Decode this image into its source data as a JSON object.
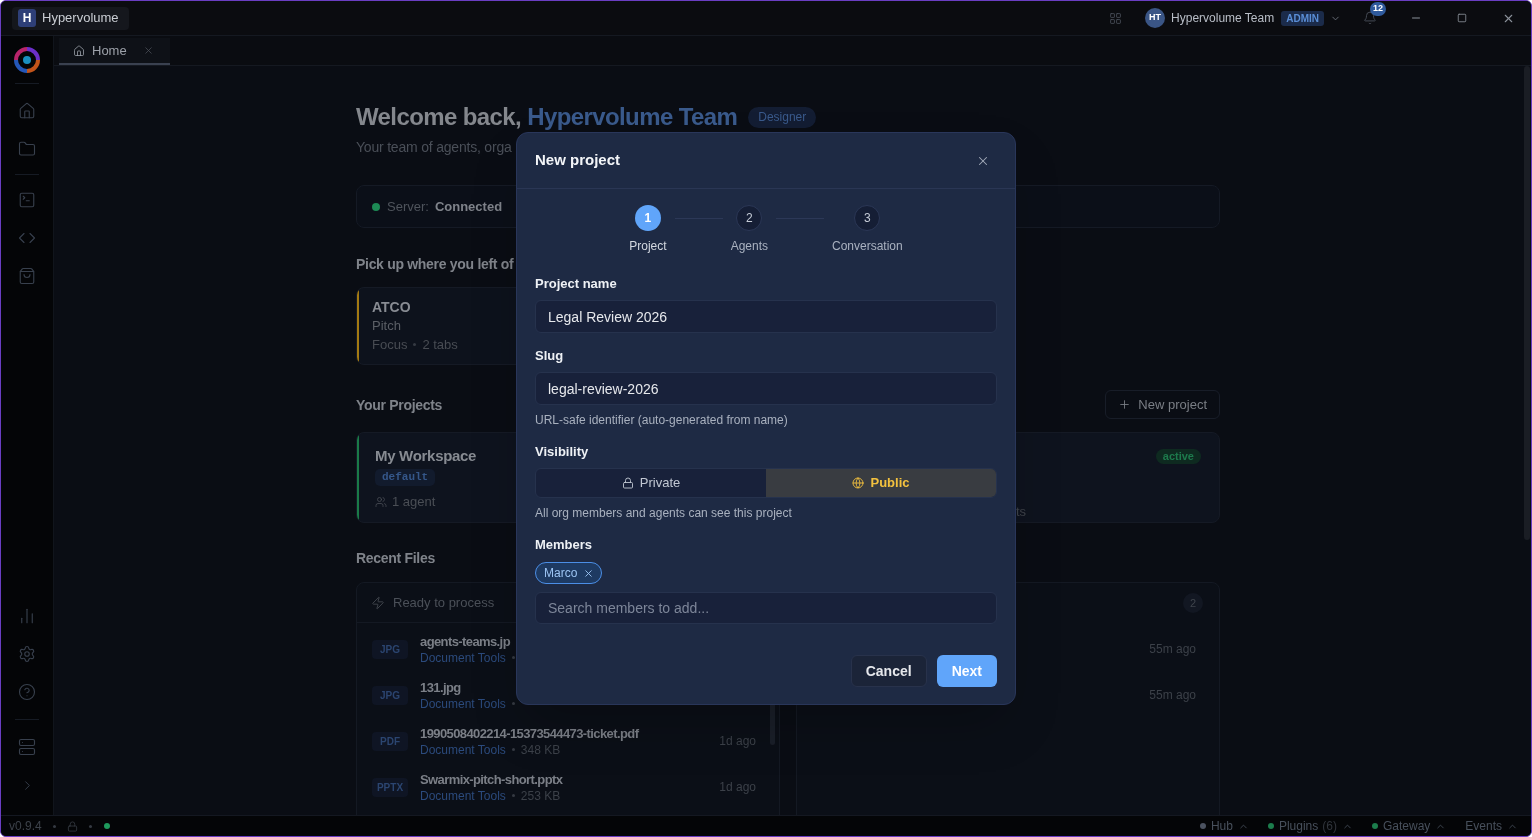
{
  "window": {
    "app_name": "Hypervolume",
    "logo_letter": "H"
  },
  "top_bar": {
    "user": {
      "initials": "HT",
      "name": "Hypervolume Team",
      "role": "ADMIN"
    },
    "notification_count": "12"
  },
  "tabs": [
    {
      "label": "Home",
      "selected": true
    }
  ],
  "welcome": {
    "greeting": "Welcome back,",
    "name": "Hypervolume Team",
    "role": "Designer",
    "subtitle": "Your team of agents, orga"
  },
  "server_status": {
    "label": "Server:",
    "value": "Connected",
    "connected": true
  },
  "continue_section": {
    "title": "Pick up where you left of",
    "cards": [
      {
        "title": "ATCO",
        "subtitle": "Pitch",
        "mode": "Focus",
        "tabs": "2 tabs",
        "color": "#a47a12"
      }
    ]
  },
  "projects": {
    "title": "Your Projects",
    "new_button": "New project",
    "cards": [
      {
        "name": "My Workspace",
        "tag": "default",
        "agents": "1 agent",
        "color": "#1a7a48"
      },
      {
        "status": "active",
        "meta": "ts"
      }
    ]
  },
  "recent_files": {
    "title": "Recent Files",
    "panels": [
      {
        "header": "Ready to process",
        "files": [
          {
            "type": "JPG",
            "name": "agents-teams.jp",
            "project": "Document Tools"
          },
          {
            "type": "JPG",
            "name": "131.jpg",
            "project": "Document Tools"
          },
          {
            "type": "PDF",
            "name": "1990508402214-15373544473-ticket.pdf",
            "project": "Document Tools",
            "size": "348 KB",
            "time": "1d ago"
          },
          {
            "type": "PPTX",
            "name": "Swarmix-pitch-short.pptx",
            "project": "Document Tools",
            "size": "253 KB",
            "time": "1d ago"
          }
        ]
      },
      {
        "count": "2",
        "files": [
          {
            "time": "55m ago"
          },
          {
            "time": "55m ago"
          }
        ]
      }
    ]
  },
  "dialog": {
    "title": "New project",
    "steps": [
      {
        "number": "1",
        "label": "Project",
        "current": true
      },
      {
        "number": "2",
        "label": "Agents",
        "current": false
      },
      {
        "number": "3",
        "label": "Conversation",
        "current": false
      }
    ],
    "project_name": {
      "label": "Project name",
      "value": "Legal Review 2026"
    },
    "slug": {
      "label": "Slug",
      "value": "legal-review-2026",
      "hint": "URL-safe identifier (auto-generated from name)"
    },
    "visibility": {
      "label": "Visibility",
      "options": [
        {
          "kind": "private",
          "label": "Private",
          "selected": false
        },
        {
          "kind": "public",
          "label": "Public",
          "selected": true
        }
      ],
      "hint": "All org members and agents can see this project"
    },
    "members": {
      "label": "Members",
      "chips": [
        {
          "label": "Marco"
        }
      ],
      "search": {
        "placeholder": "Search members to add..."
      }
    },
    "buttons": [
      {
        "kind": "secondary",
        "label": "Cancel"
      },
      {
        "kind": "primary",
        "label": "Next"
      }
    ]
  },
  "status_bar": {
    "version": "v0.9.4",
    "online": true,
    "items": [
      {
        "label": "Hub",
        "color": "#4b5260"
      },
      {
        "label": "Plugins",
        "count": "(6)",
        "color": "#1c7d4c"
      },
      {
        "label": "Gateway",
        "color": "#1c7d4c"
      },
      {
        "label": "Events"
      }
    ]
  }
}
